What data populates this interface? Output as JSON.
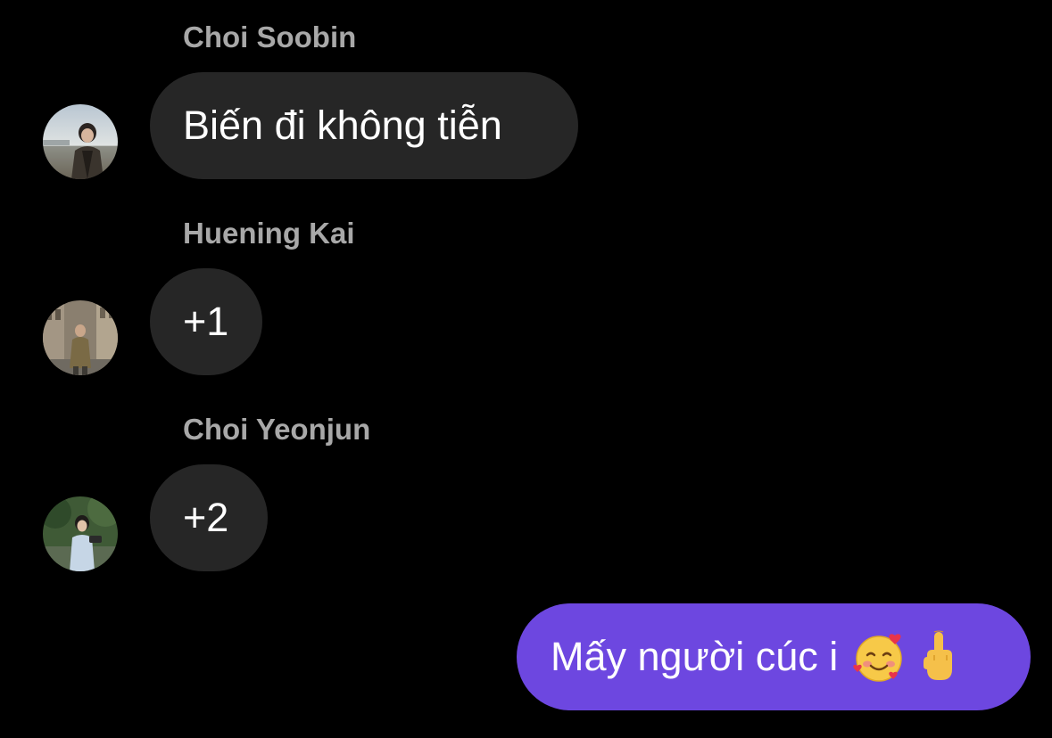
{
  "messages": [
    {
      "sender": "Choi Soobin",
      "text": "Biến đi không tiễn",
      "avatar_icon": "soobin-avatar"
    },
    {
      "sender": "Huening Kai",
      "text": "+1",
      "avatar_icon": "huening-kai-avatar"
    },
    {
      "sender": "Choi Yeonjun",
      "text": "+2",
      "avatar_icon": "yeonjun-avatar"
    }
  ],
  "outgoing": {
    "text": "Mấy người cúc i",
    "emojis": [
      "smiling-face-with-hearts-icon",
      "middle-finger-icon"
    ]
  },
  "colors": {
    "background": "#000000",
    "incoming_bubble": "#262626",
    "outgoing_bubble": "#6d47e0",
    "sender_name": "#a8a8a8"
  }
}
